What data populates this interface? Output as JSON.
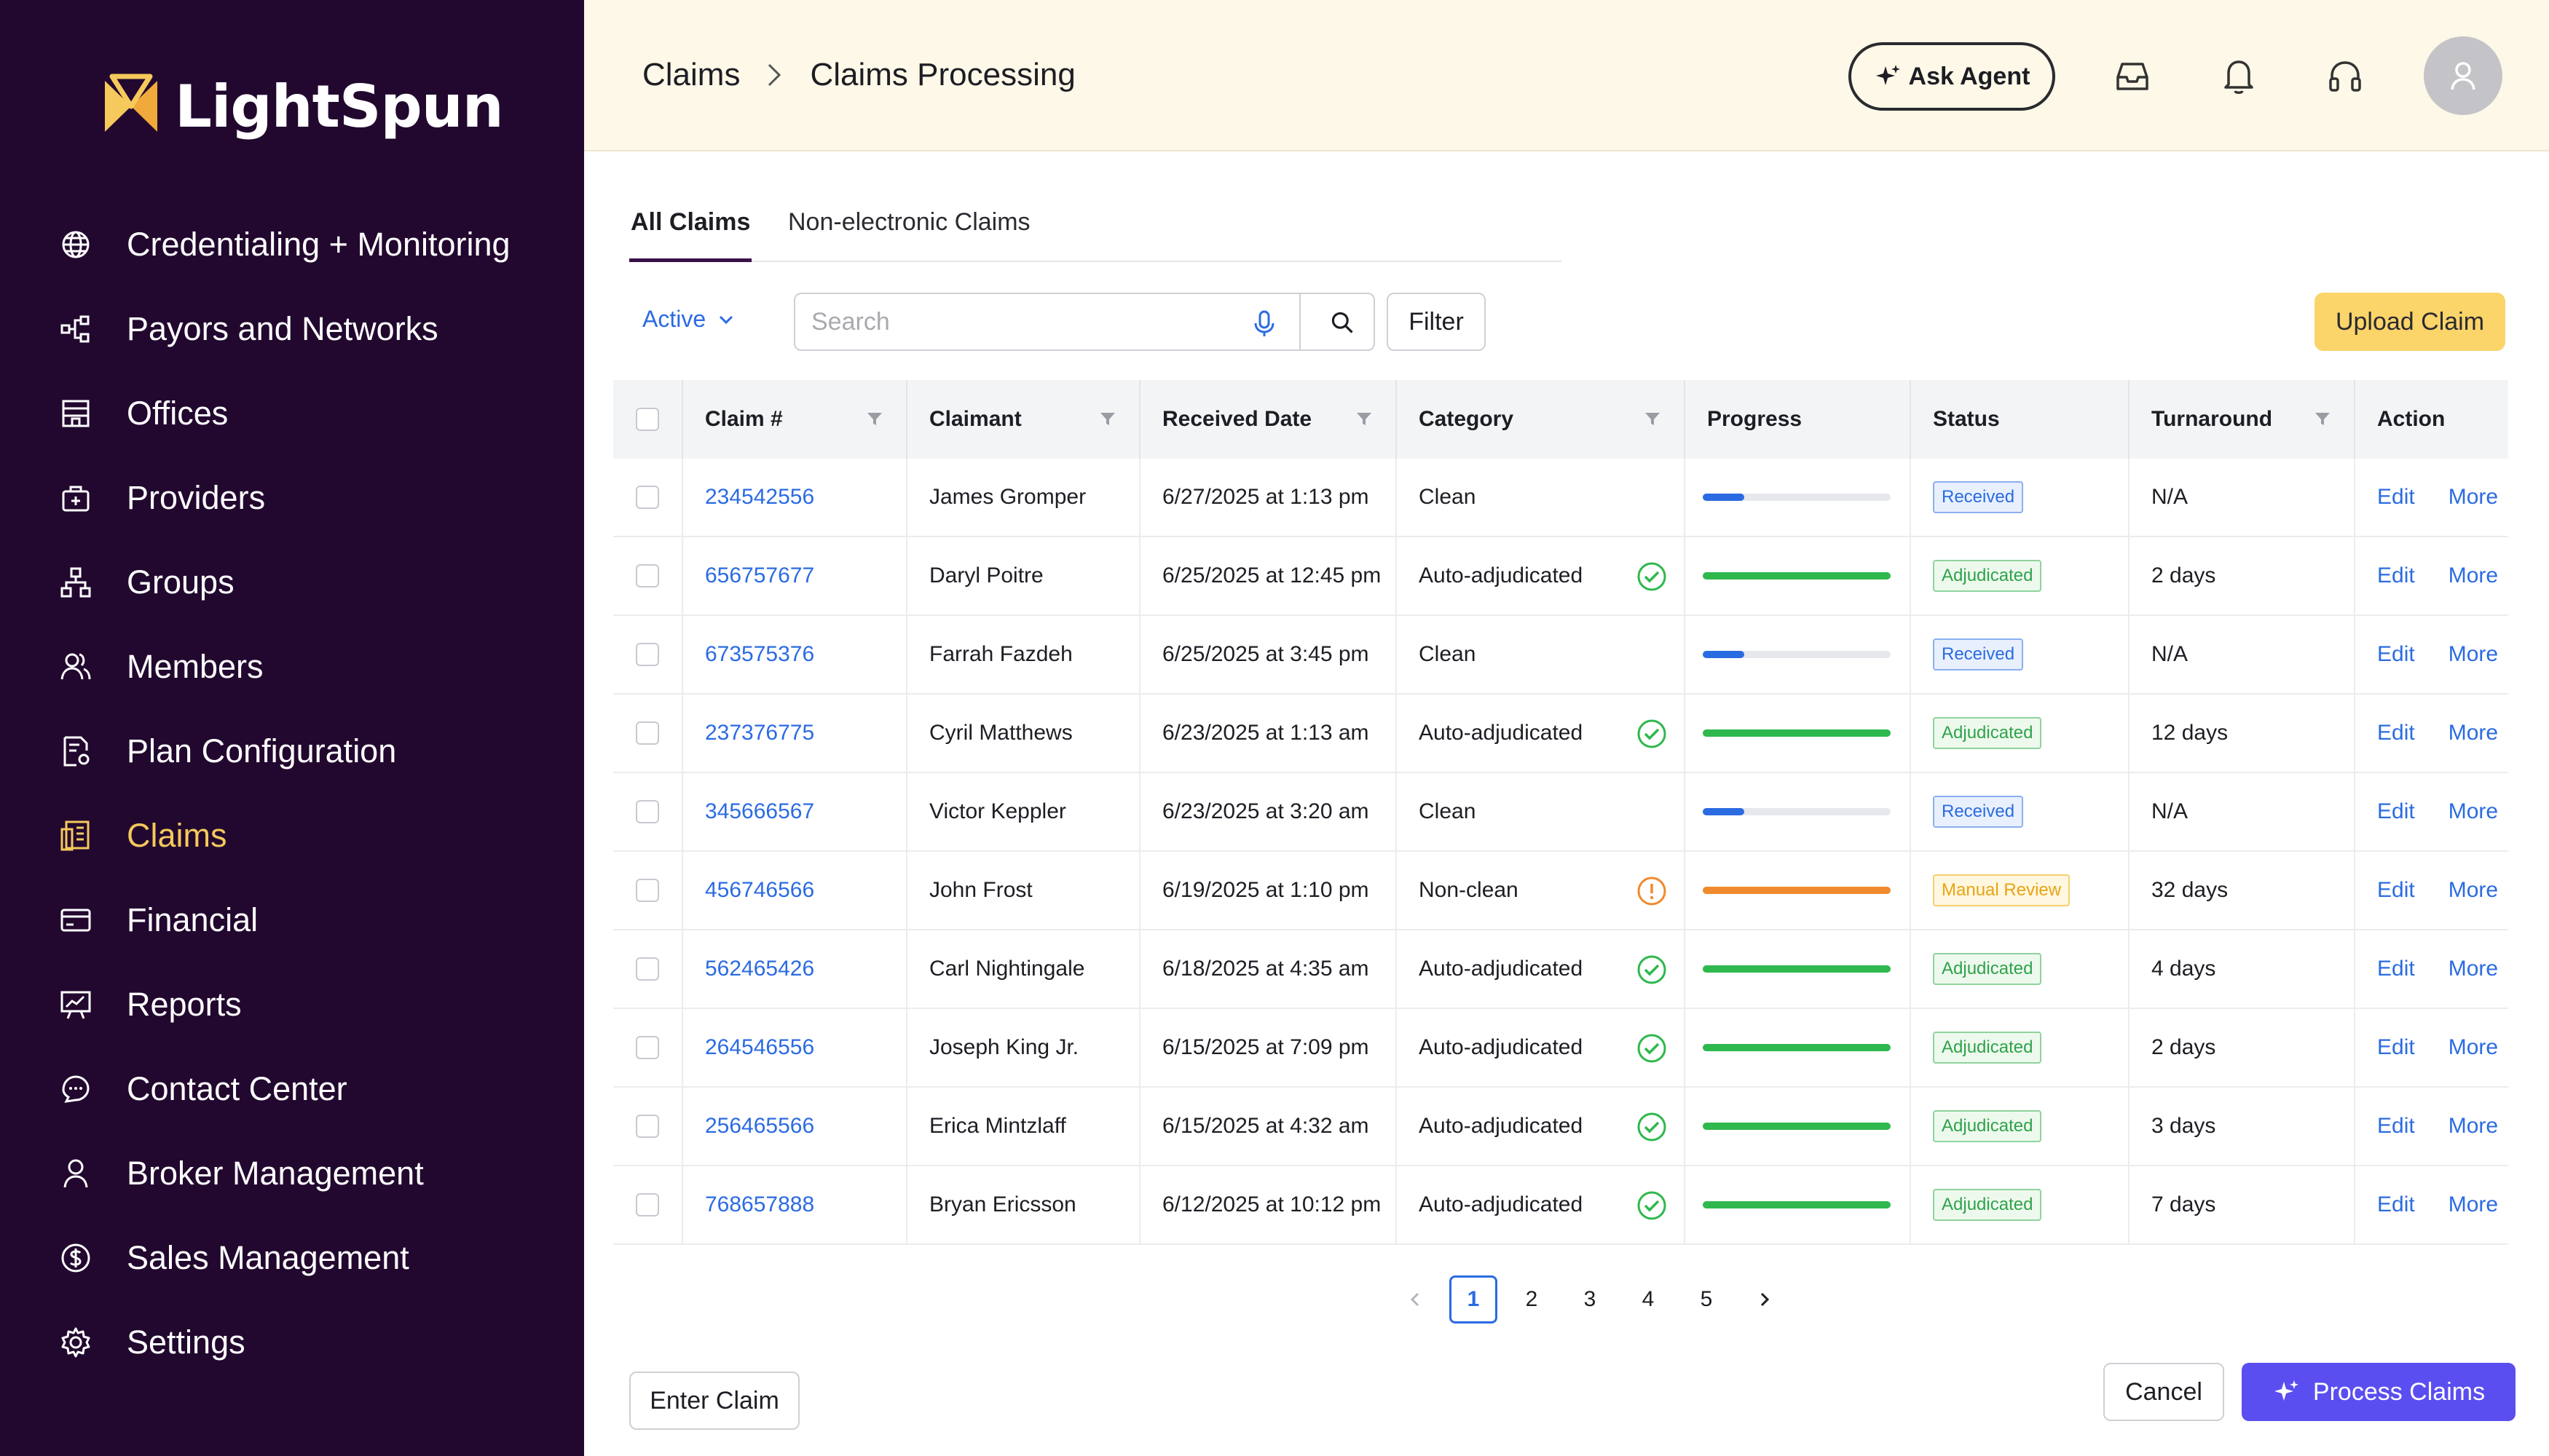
{
  "app": {
    "brand": "LightSpun"
  },
  "sidebar": {
    "items": [
      {
        "label": "Credentialing + Monitoring",
        "icon": "globe-icon"
      },
      {
        "label": "Payors and Networks",
        "icon": "network-icon"
      },
      {
        "label": "Offices",
        "icon": "building-icon"
      },
      {
        "label": "Providers",
        "icon": "medical-bag-icon"
      },
      {
        "label": "Groups",
        "icon": "org-chart-icon"
      },
      {
        "label": "Members",
        "icon": "members-icon"
      },
      {
        "label": "Plan Configuration",
        "icon": "document-settings-icon"
      },
      {
        "label": "Claims",
        "icon": "claims-icon",
        "active": true
      },
      {
        "label": "Financial",
        "icon": "credit-card-icon"
      },
      {
        "label": "Reports",
        "icon": "presentation-chart-icon"
      },
      {
        "label": "Contact Center",
        "icon": "chat-bubbles-icon"
      },
      {
        "label": "Broker Management",
        "icon": "person-icon"
      },
      {
        "label": "Sales Management",
        "icon": "dollar-icon"
      },
      {
        "label": "Settings",
        "icon": "gear-icon"
      }
    ],
    "active_color": "#f5c95b"
  },
  "header": {
    "breadcrumb": [
      "Claims",
      "Claims Processing"
    ],
    "ask_agent": "Ask Agent"
  },
  "tabs": [
    {
      "label": "All Claims",
      "active": true
    },
    {
      "label": "Non-electronic Claims",
      "active": false
    }
  ],
  "toolbar": {
    "status_filter": "Active",
    "search_placeholder": "Search",
    "filter_label": "Filter",
    "upload_label": "Upload Claim"
  },
  "table": {
    "columns": [
      "Claim #",
      "Claimant",
      "Received Date",
      "Category",
      "Progress",
      "Status",
      "Turnaround",
      "Action"
    ],
    "rows": [
      {
        "claim": "234542556",
        "claimant": "James Gromper",
        "date": "6/27/2025 at 1:13 pm",
        "category": "Clean",
        "cat_icon": "",
        "progress": 0.22,
        "progress_color": "#2b6be2",
        "status": "Received",
        "status_type": "received",
        "turnaround": "N/A"
      },
      {
        "claim": "656757677",
        "claimant": "Daryl Poitre",
        "date": "6/25/2025 at 12:45 pm",
        "category": "Auto-adjudicated",
        "cat_icon": "check-circle-icon",
        "progress": 1.0,
        "progress_color": "#2fb84d",
        "status": "Adjudicated",
        "status_type": "adjudicated",
        "turnaround": "2 days"
      },
      {
        "claim": "673575376",
        "claimant": "Farrah Fazdeh",
        "date": "6/25/2025 at 3:45 pm",
        "category": "Clean",
        "cat_icon": "",
        "progress": 0.22,
        "progress_color": "#2b6be2",
        "status": "Received",
        "status_type": "received",
        "turnaround": "N/A"
      },
      {
        "claim": "237376775",
        "claimant": "Cyril Matthews",
        "date": "6/23/2025 at 1:13 am",
        "category": "Auto-adjudicated",
        "cat_icon": "check-circle-icon",
        "progress": 1.0,
        "progress_color": "#2fb84d",
        "status": "Adjudicated",
        "status_type": "adjudicated",
        "turnaround": "12 days"
      },
      {
        "claim": "345666567",
        "claimant": "Victor Keppler",
        "date": "6/23/2025 at 3:20 am",
        "category": "Clean",
        "cat_icon": "",
        "progress": 0.22,
        "progress_color": "#2b6be2",
        "status": "Received",
        "status_type": "received",
        "turnaround": "N/A"
      },
      {
        "claim": "456746566",
        "claimant": "John Frost",
        "date": "6/19/2025 at 1:10 pm",
        "category": "Non-clean",
        "cat_icon": "warning-circle-icon",
        "progress": 1.0,
        "progress_color": "#f08a2c",
        "status": "Manual Review",
        "status_type": "manual",
        "turnaround": "32 days"
      },
      {
        "claim": "562465426",
        "claimant": "Carl Nightingale",
        "date": "6/18/2025 at 4:35 am",
        "category": "Auto-adjudicated",
        "cat_icon": "check-circle-icon",
        "progress": 1.0,
        "progress_color": "#2fb84d",
        "status": "Adjudicated",
        "status_type": "adjudicated",
        "turnaround": "4 days"
      },
      {
        "claim": "264546556",
        "claimant": "Joseph King Jr.",
        "date": "6/15/2025 at 7:09 pm",
        "category": "Auto-adjudicated",
        "cat_icon": "check-circle-icon",
        "progress": 1.0,
        "progress_color": "#2fb84d",
        "status": "Adjudicated",
        "status_type": "adjudicated",
        "turnaround": "2 days"
      },
      {
        "claim": "256465566",
        "claimant": "Erica Mintzlaff",
        "date": "6/15/2025 at 4:32 am",
        "category": "Auto-adjudicated",
        "cat_icon": "check-circle-icon",
        "progress": 1.0,
        "progress_color": "#2fb84d",
        "status": "Adjudicated",
        "status_type": "adjudicated",
        "turnaround": "3 days"
      },
      {
        "claim": "768657888",
        "claimant": "Bryan Ericsson",
        "date": "6/12/2025 at 10:12 pm",
        "category": "Auto-adjudicated",
        "cat_icon": "check-circle-icon",
        "progress": 1.0,
        "progress_color": "#2fb84d",
        "status": "Adjudicated",
        "status_type": "adjudicated",
        "turnaround": "7 days"
      }
    ],
    "actions": [
      "Edit",
      "More"
    ]
  },
  "pagination": {
    "pages": [
      "1",
      "2",
      "3",
      "4",
      "5"
    ],
    "current": "1"
  },
  "footer": {
    "enter_claim": "Enter Claim",
    "cancel": "Cancel",
    "process": "Process Claims"
  }
}
